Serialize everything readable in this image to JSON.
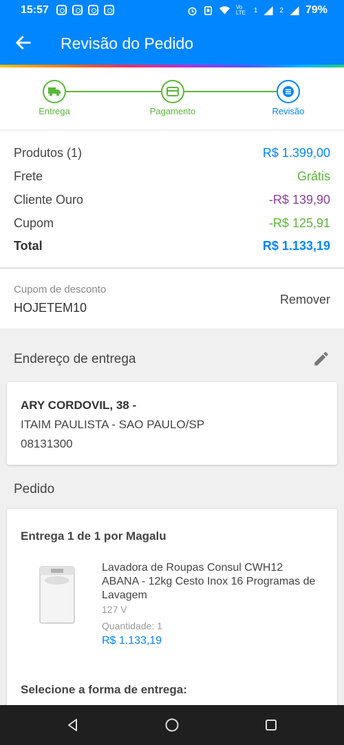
{
  "status_bar": {
    "time": "15:57",
    "battery": "79%",
    "vo_lte_label": "Vo LTE",
    "network_1": "1",
    "network_2": "2",
    "notification_icons": [
      "instagram-icon",
      "instagram-icon",
      "instagram-icon",
      "instagram-icon"
    ],
    "right_icons": [
      "alarm-icon",
      "vibrate-icon",
      "wifi-icon",
      "signal-icon",
      "signal-icon"
    ]
  },
  "header": {
    "title": "Revisão do Pedido"
  },
  "steps": [
    {
      "label": "Entrega",
      "icon": "truck-icon",
      "state": "done"
    },
    {
      "label": "Pagamento",
      "icon": "card-icon",
      "state": "done"
    },
    {
      "label": "Revisão",
      "icon": "list-icon",
      "state": "active"
    }
  ],
  "summary": {
    "products_label": "Produtos (1)",
    "products_value": "R$ 1.399,00",
    "shipping_label": "Frete",
    "shipping_value": "Grátis",
    "gold_label": "Cliente Ouro",
    "gold_value": "-R$ 139,90",
    "coupon_label": "Cupom",
    "coupon_value": "-R$ 125,91",
    "total_label": "Total",
    "total_value": "R$ 1.133,19"
  },
  "coupon": {
    "label": "Cupom de desconto",
    "code": "HOJETEM10",
    "remove_label": "Remover"
  },
  "address": {
    "section_title": "Endereço de entrega",
    "line1": "ARY CORDOVIL, 38 -",
    "line2": "ITAIM PAULISTA - SAO PAULO/SP",
    "zip": "08131300"
  },
  "order": {
    "section_title": "Pedido",
    "delivery_title": "Entrega 1 de 1 por Magalu",
    "product_name": "Lavadora de Roupas Consul CWH12 ABANA - 12kg Cesto Inox 16 Programas de Lavagem",
    "voltage": "127 V",
    "quantity": "Quantidade:  1",
    "price": "R$ 1.133,19",
    "select_delivery": "Selecione a forma de entrega:"
  },
  "colors": {
    "primary": "#0086ff",
    "green": "#58b935",
    "purple": "#8e3f9e",
    "nav": "#1f1f1f"
  }
}
